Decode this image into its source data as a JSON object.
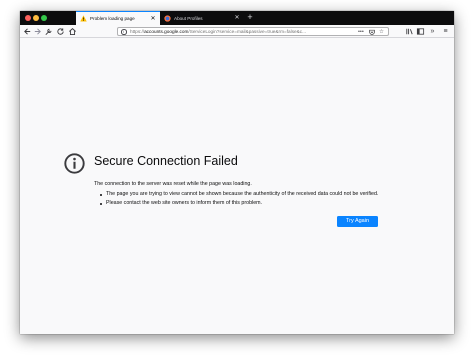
{
  "window": {
    "tabs": [
      {
        "title": "Problem loading page",
        "icon": "warning-icon",
        "active": true
      },
      {
        "title": "About Profiles",
        "icon": "firefox-icon",
        "active": false
      }
    ],
    "new_tab_symbol": "+"
  },
  "toolbar": {
    "url_scheme": "https://",
    "url_host": "accounts.google.com",
    "url_path": "/ServiceLogin?service=mail&passive=true&rm=false&c...",
    "icons": [
      "back-icon",
      "forward-icon",
      "customize-icon",
      "reload-icon",
      "home-icon",
      "page-actions-icon",
      "pocket-icon",
      "bookmark-star-icon",
      "library-icon",
      "sidebar-icon",
      "overflow-icon",
      "menu-icon"
    ]
  },
  "error": {
    "title": "Secure Connection Failed",
    "description": "The connection to the server was reset while the page was loading.",
    "bullets": [
      "The page you are trying to view cannot be shown because the authenticity of the received data could not be verified.",
      "Please contact the web site owners to inform them of this problem."
    ],
    "button_label": "Try Again"
  },
  "colors": {
    "accent": "#0a84ff",
    "tabstrip": "#0c0c0d",
    "page_bg": "#f9f9fa"
  }
}
